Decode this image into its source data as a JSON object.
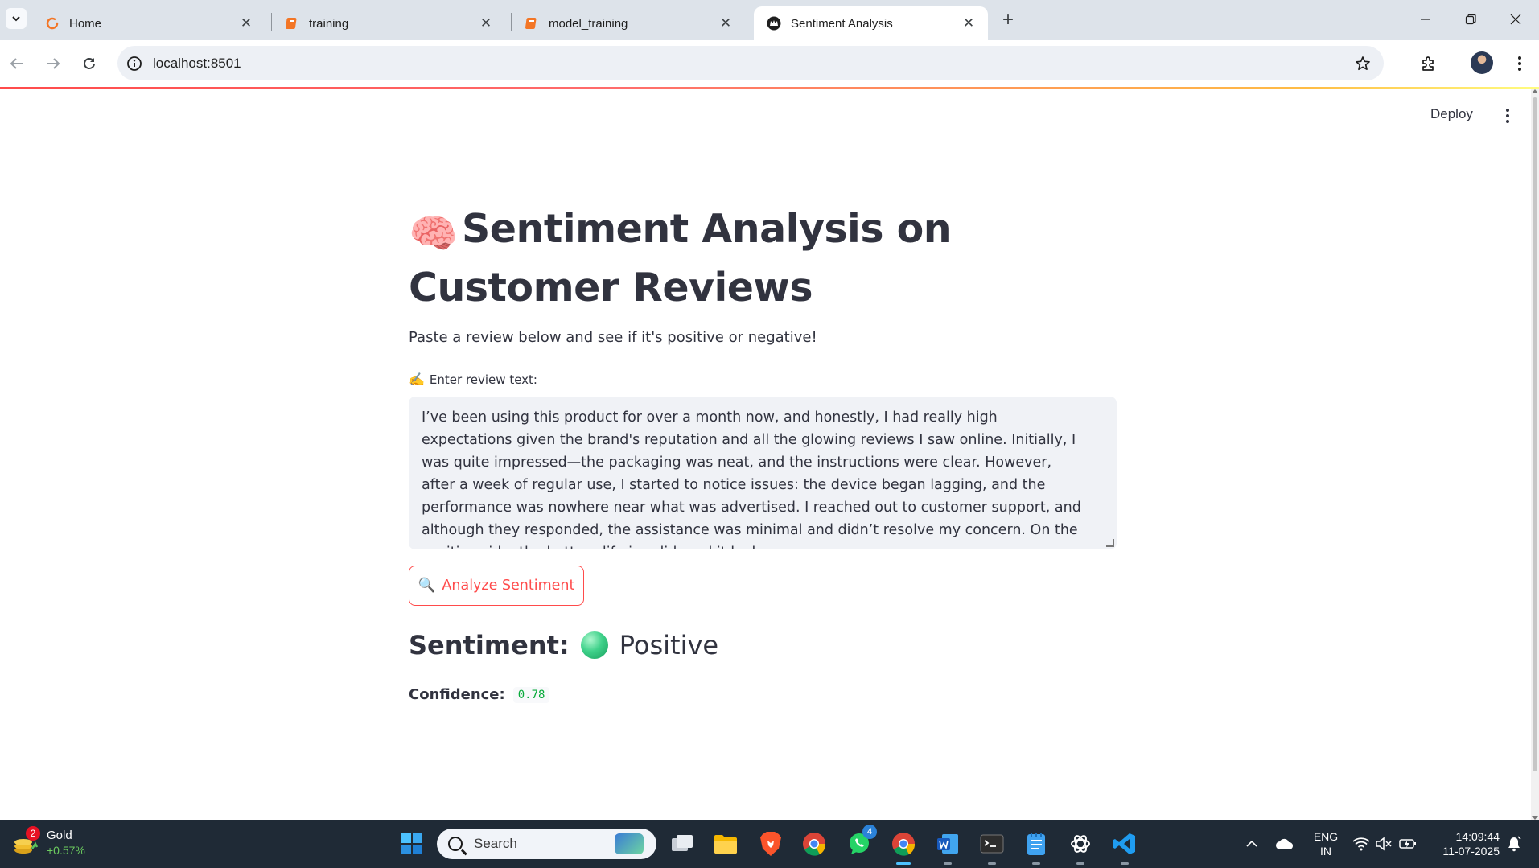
{
  "browser": {
    "tabs": [
      {
        "title": "Home",
        "icon": "loading-spinner-icon"
      },
      {
        "title": "training",
        "icon": "notebook-icon"
      },
      {
        "title": "model_training",
        "icon": "notebook-icon"
      },
      {
        "title": "Sentiment Analysis",
        "icon": "streamlit-crown-icon",
        "active": true
      }
    ],
    "url": "localhost:8501"
  },
  "app": {
    "deploy_label": "Deploy",
    "title_emoji": "🧠",
    "title": "Sentiment Analysis on Customer Reviews",
    "subtitle": "Paste a review below and see if it's positive or negative!",
    "input_label_emoji": "✍️",
    "input_label": "Enter review text:",
    "review_text": "I’ve been using this product for over a month now, and honestly, I had really high expectations given the brand's reputation and all the glowing reviews I saw online. Initially, I was quite impressed—the packaging was neat, and the instructions were clear. However, after a week of regular use, I started to notice issues: the device began lagging, and the performance was nowhere near what was advertised. I reached out to customer support, and although they responded, the assistance was minimal and didn’t resolve my concern. On the positive side, the battery life is solid, and it looks",
    "button_emoji": "🔍",
    "button_label": "Analyze Sentiment",
    "sentiment_label": "Sentiment:",
    "sentiment_value": "Positive",
    "sentiment_color": "#3fd18a",
    "confidence_label": "Confidence:",
    "confidence_value": "0.78"
  },
  "taskbar": {
    "widget_badge": "2",
    "widget_title": "Gold",
    "widget_change": "+0.57%",
    "search_placeholder": "Search",
    "whatsapp_badge": "4",
    "lang_line1": "ENG",
    "lang_line2": "IN",
    "time": "14:09:44",
    "date": "11-07-2025"
  },
  "colors": {
    "accent": "#ff4b4b",
    "text": "#31333f",
    "input_bg": "#f0f2f6",
    "taskbar_bg": "#1f2a36"
  }
}
